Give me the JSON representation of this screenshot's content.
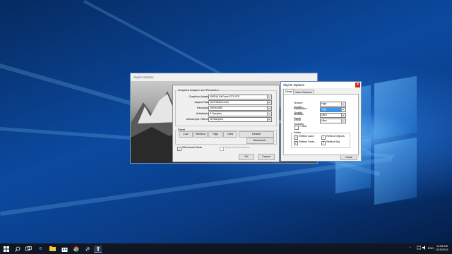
{
  "launcher": {
    "title": "Skyrim Options",
    "group_title": "Graphics Adapter and Resolution",
    "fields": [
      {
        "label": "Graphics Adapter",
        "value": "NVIDIA GeForce GTX 970"
      },
      {
        "label": "Aspect Ratio",
        "value": "16:9 Widescreen"
      },
      {
        "label": "Resolution",
        "value": "1920x1080"
      },
      {
        "label": "Antialiasing",
        "value": "8 Samples"
      },
      {
        "label": "Anisotropic Filtering",
        "value": "16 Samples"
      }
    ],
    "detail_label": "Detail",
    "detail_buttons": [
      "Low",
      "Medium",
      "High",
      "Ultra"
    ],
    "default_label": "Default",
    "advanced_label": "Advanced...",
    "windowed_mode_label": "Windowed Mode",
    "show_all_resolutions_label": "Show All Resolutions",
    "ok_label": "OK",
    "cancel_label": "Cancel"
  },
  "skyrim_options": {
    "title": "Skyrim Options",
    "close_glyph": "✕",
    "tabs": [
      "Detail",
      "View Distance"
    ],
    "fields": [
      {
        "label": "Texture Quality",
        "value": "High"
      },
      {
        "label": "Radial Blur Quality",
        "value": "High"
      },
      {
        "label": "Shadow Detail",
        "value": "Ultra"
      },
      {
        "label": "Decal Quantity",
        "value": "Ultra"
      }
    ],
    "fxaa_label": "FXAA",
    "water_label": "Water",
    "water_options": [
      "Reflect Land",
      "Reflect Objects",
      "Reflect Trees",
      "Reflect Sky"
    ],
    "close_label": "Close"
  },
  "taskbar": {
    "start_icon": "windows-logo-icon",
    "pinned": [
      "search",
      "task-view",
      "edge",
      "file-explorer",
      "store",
      "chrome",
      "steam",
      "skyrim"
    ],
    "language": "ENG",
    "time": "11:58 AM",
    "date": "5/15/2016"
  }
}
